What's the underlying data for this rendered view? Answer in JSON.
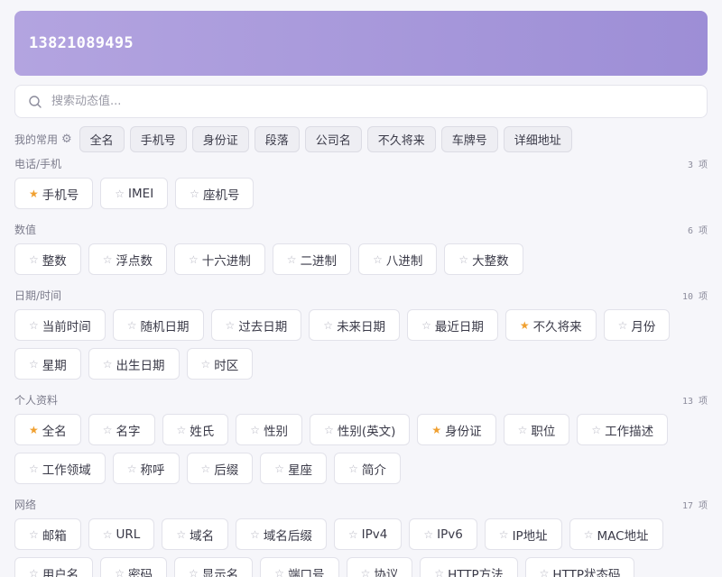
{
  "result": {
    "value": "13821089495"
  },
  "search": {
    "placeholder": "搜索动态值..."
  },
  "favorites": {
    "label": "我的常用",
    "items": [
      "全名",
      "手机号",
      "身份证",
      "段落",
      "公司名",
      "不久将来",
      "车牌号",
      "详细地址"
    ]
  },
  "categories": [
    {
      "title": "电话/手机",
      "count": "3 项",
      "items": [
        {
          "label": "手机号",
          "starred": true
        },
        {
          "label": "IMEI",
          "starred": false
        },
        {
          "label": "座机号",
          "starred": false
        }
      ]
    },
    {
      "title": "数值",
      "count": "6 项",
      "items": [
        {
          "label": "整数",
          "starred": false
        },
        {
          "label": "浮点数",
          "starred": false
        },
        {
          "label": "十六进制",
          "starred": false
        },
        {
          "label": "二进制",
          "starred": false
        },
        {
          "label": "八进制",
          "starred": false
        },
        {
          "label": "大整数",
          "starred": false
        }
      ]
    },
    {
      "title": "日期/时间",
      "count": "10 项",
      "items": [
        {
          "label": "当前时间",
          "starred": false
        },
        {
          "label": "随机日期",
          "starred": false
        },
        {
          "label": "过去日期",
          "starred": false
        },
        {
          "label": "未来日期",
          "starred": false
        },
        {
          "label": "最近日期",
          "starred": false
        },
        {
          "label": "不久将来",
          "starred": true
        },
        {
          "label": "月份",
          "starred": false
        },
        {
          "label": "星期",
          "starred": false
        },
        {
          "label": "出生日期",
          "starred": false
        },
        {
          "label": "时区",
          "starred": false
        }
      ]
    },
    {
      "title": "个人资料",
      "count": "13 项",
      "items": [
        {
          "label": "全名",
          "starred": true
        },
        {
          "label": "名字",
          "starred": false
        },
        {
          "label": "姓氏",
          "starred": false
        },
        {
          "label": "性别",
          "starred": false
        },
        {
          "label": "性别(英文)",
          "starred": false
        },
        {
          "label": "身份证",
          "starred": true
        },
        {
          "label": "职位",
          "starred": false
        },
        {
          "label": "工作描述",
          "starred": false
        },
        {
          "label": "工作领域",
          "starred": false
        },
        {
          "label": "称呼",
          "starred": false
        },
        {
          "label": "后缀",
          "starred": false
        },
        {
          "label": "星座",
          "starred": false
        },
        {
          "label": "简介",
          "starred": false
        }
      ]
    },
    {
      "title": "网络",
      "count": "17 项",
      "items": [
        {
          "label": "邮箱",
          "starred": false
        },
        {
          "label": "URL",
          "starred": false
        },
        {
          "label": "域名",
          "starred": false
        },
        {
          "label": "域名后缀",
          "starred": false
        },
        {
          "label": "IPv4",
          "starred": false
        },
        {
          "label": "IPv6",
          "starred": false
        },
        {
          "label": "IP地址",
          "starred": false
        },
        {
          "label": "MAC地址",
          "starred": false
        },
        {
          "label": "用户名",
          "starred": false
        },
        {
          "label": "密码",
          "starred": false
        },
        {
          "label": "显示名",
          "starred": false
        },
        {
          "label": "端口号",
          "starred": false
        },
        {
          "label": "协议",
          "starred": false
        },
        {
          "label": "HTTP方法",
          "starred": false
        },
        {
          "label": "HTTP状态码",
          "starred": false
        }
      ]
    }
  ],
  "icons": {
    "search": "search-icon",
    "settings": "gear-icon",
    "star_on": "star-filled-icon",
    "star_off": "star-outline-icon"
  },
  "colors": {
    "banner_start": "#b3a4e0",
    "banner_end": "#9d8ed6",
    "star_active": "#f0a030",
    "star_inactive": "#b4b4c0"
  }
}
